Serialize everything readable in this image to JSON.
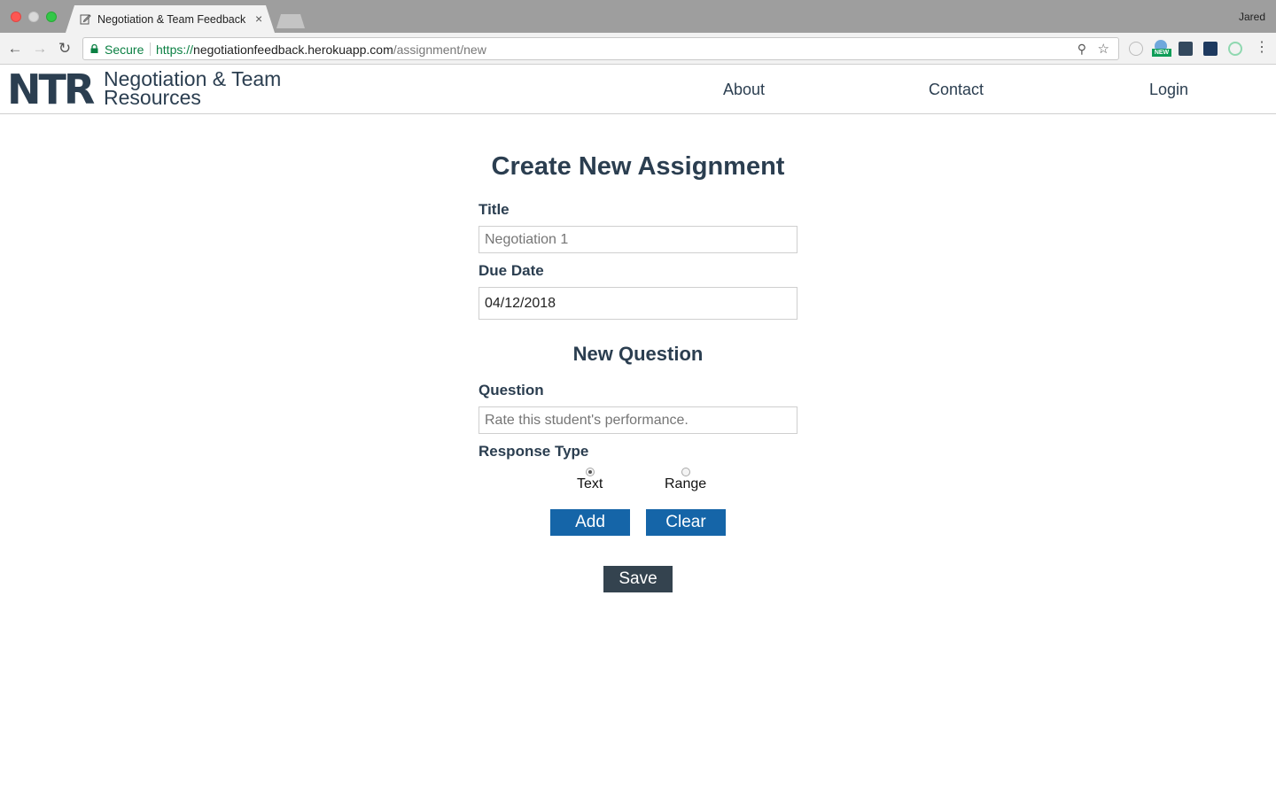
{
  "browser": {
    "tab_title": "Negotiation & Team Feedback",
    "tab_close": "×",
    "profile_name": "Jared",
    "secure_label": "Secure",
    "url_scheme": "https://",
    "url_host": "negotiationfeedback.herokuapp.com",
    "url_path": "/assignment/new",
    "ext_badge": "NEW",
    "icons": [
      "back-arrow-icon",
      "forward-arrow-icon",
      "reload-icon",
      "lock-icon",
      "zoom-icon",
      "star-icon",
      "menu-icon"
    ]
  },
  "header": {
    "logo_mark": "NTR",
    "logo_line1": "Negotiation & Team",
    "logo_line2": "Resources",
    "nav": {
      "about": "About",
      "contact": "Contact",
      "login": "Login"
    }
  },
  "form": {
    "page_title": "Create New Assignment",
    "title_label": "Title",
    "title_placeholder": "Negotiation 1",
    "due_date_label": "Due Date",
    "due_date_value": "04/12/2018",
    "new_question_heading": "New Question",
    "question_label": "Question",
    "question_placeholder": "Rate this student's performance.",
    "response_type_label": "Response Type",
    "response_options": [
      {
        "label": "Text",
        "selected": true
      },
      {
        "label": "Range",
        "selected": false
      }
    ],
    "add_label": "Add",
    "clear_label": "Clear",
    "save_label": "Save"
  },
  "colors": {
    "brand_navy": "#2b3e50",
    "button_blue": "#1565a8",
    "save_dark": "#34434f",
    "secure_green": "#0b8043"
  }
}
